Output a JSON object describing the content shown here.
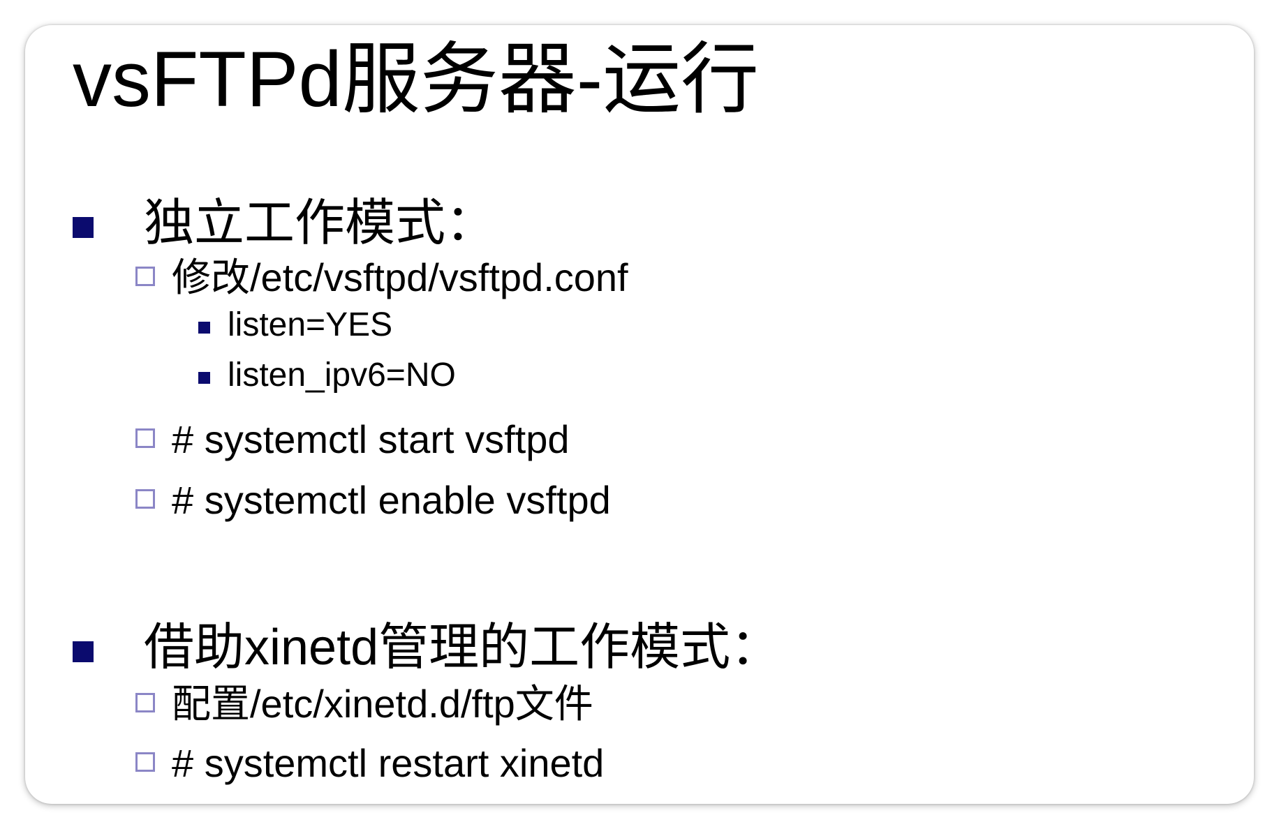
{
  "slide": {
    "title": "vsFTPd服务器-运行",
    "sections": [
      {
        "heading": "独立工作模式：",
        "items": [
          {
            "text": "修改/etc/vsftpd/vsftpd.conf",
            "subitems": [
              "listen=YES",
              "listen_ipv6=NO"
            ]
          },
          {
            "text": "# systemctl start  vsftpd"
          },
          {
            "text": "# systemctl enable vsftpd"
          }
        ]
      },
      {
        "heading": "借助xinetd管理的工作模式：",
        "items": [
          {
            "text": "配置/etc/xinetd.d/ftp文件"
          },
          {
            "text": "# systemctl restart xinetd"
          }
        ]
      }
    ]
  },
  "colors": {
    "solid_bullet": "#0b0b6e",
    "hollow_bullet_border": "#8b86c6",
    "text": "#000000",
    "background": "#ffffff"
  }
}
